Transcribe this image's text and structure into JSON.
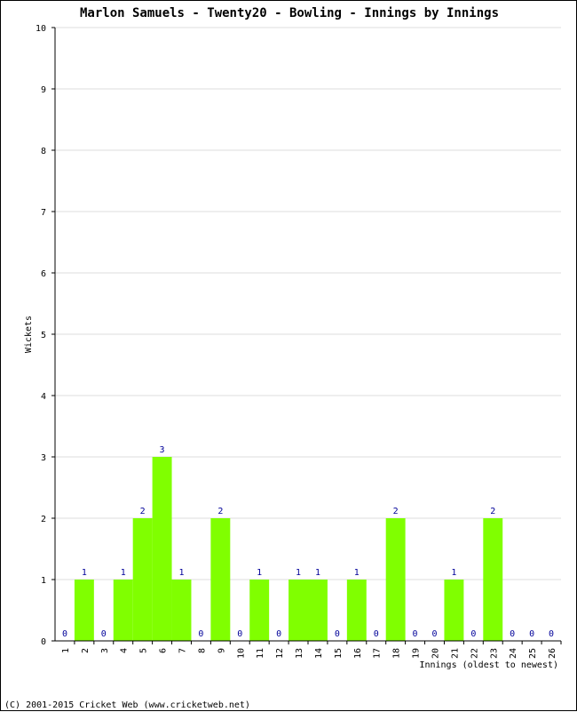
{
  "chart_data": {
    "type": "bar",
    "title": "Marlon Samuels - Twenty20 - Bowling - Innings by Innings",
    "xlabel": "Innings (oldest to newest)",
    "ylabel": "Wickets",
    "ylim": [
      0,
      10
    ],
    "yticks": [
      0,
      1,
      2,
      3,
      4,
      5,
      6,
      7,
      8,
      9,
      10
    ],
    "grid": true,
    "categories": [
      "1",
      "2",
      "3",
      "4",
      "5",
      "6",
      "7",
      "8",
      "9",
      "10",
      "11",
      "12",
      "13",
      "14",
      "15",
      "16",
      "17",
      "18",
      "19",
      "20",
      "21",
      "22",
      "23",
      "24",
      "25",
      "26"
    ],
    "values": [
      0,
      1,
      0,
      1,
      2,
      3,
      1,
      0,
      2,
      0,
      1,
      0,
      1,
      1,
      0,
      1,
      0,
      2,
      0,
      0,
      1,
      0,
      2,
      0,
      0,
      0
    ],
    "colors": {
      "bar": "#80ff00",
      "label": "#000099",
      "grid": "#dddddd"
    }
  },
  "footer": "(C) 2001-2015 Cricket Web (www.cricketweb.net)"
}
